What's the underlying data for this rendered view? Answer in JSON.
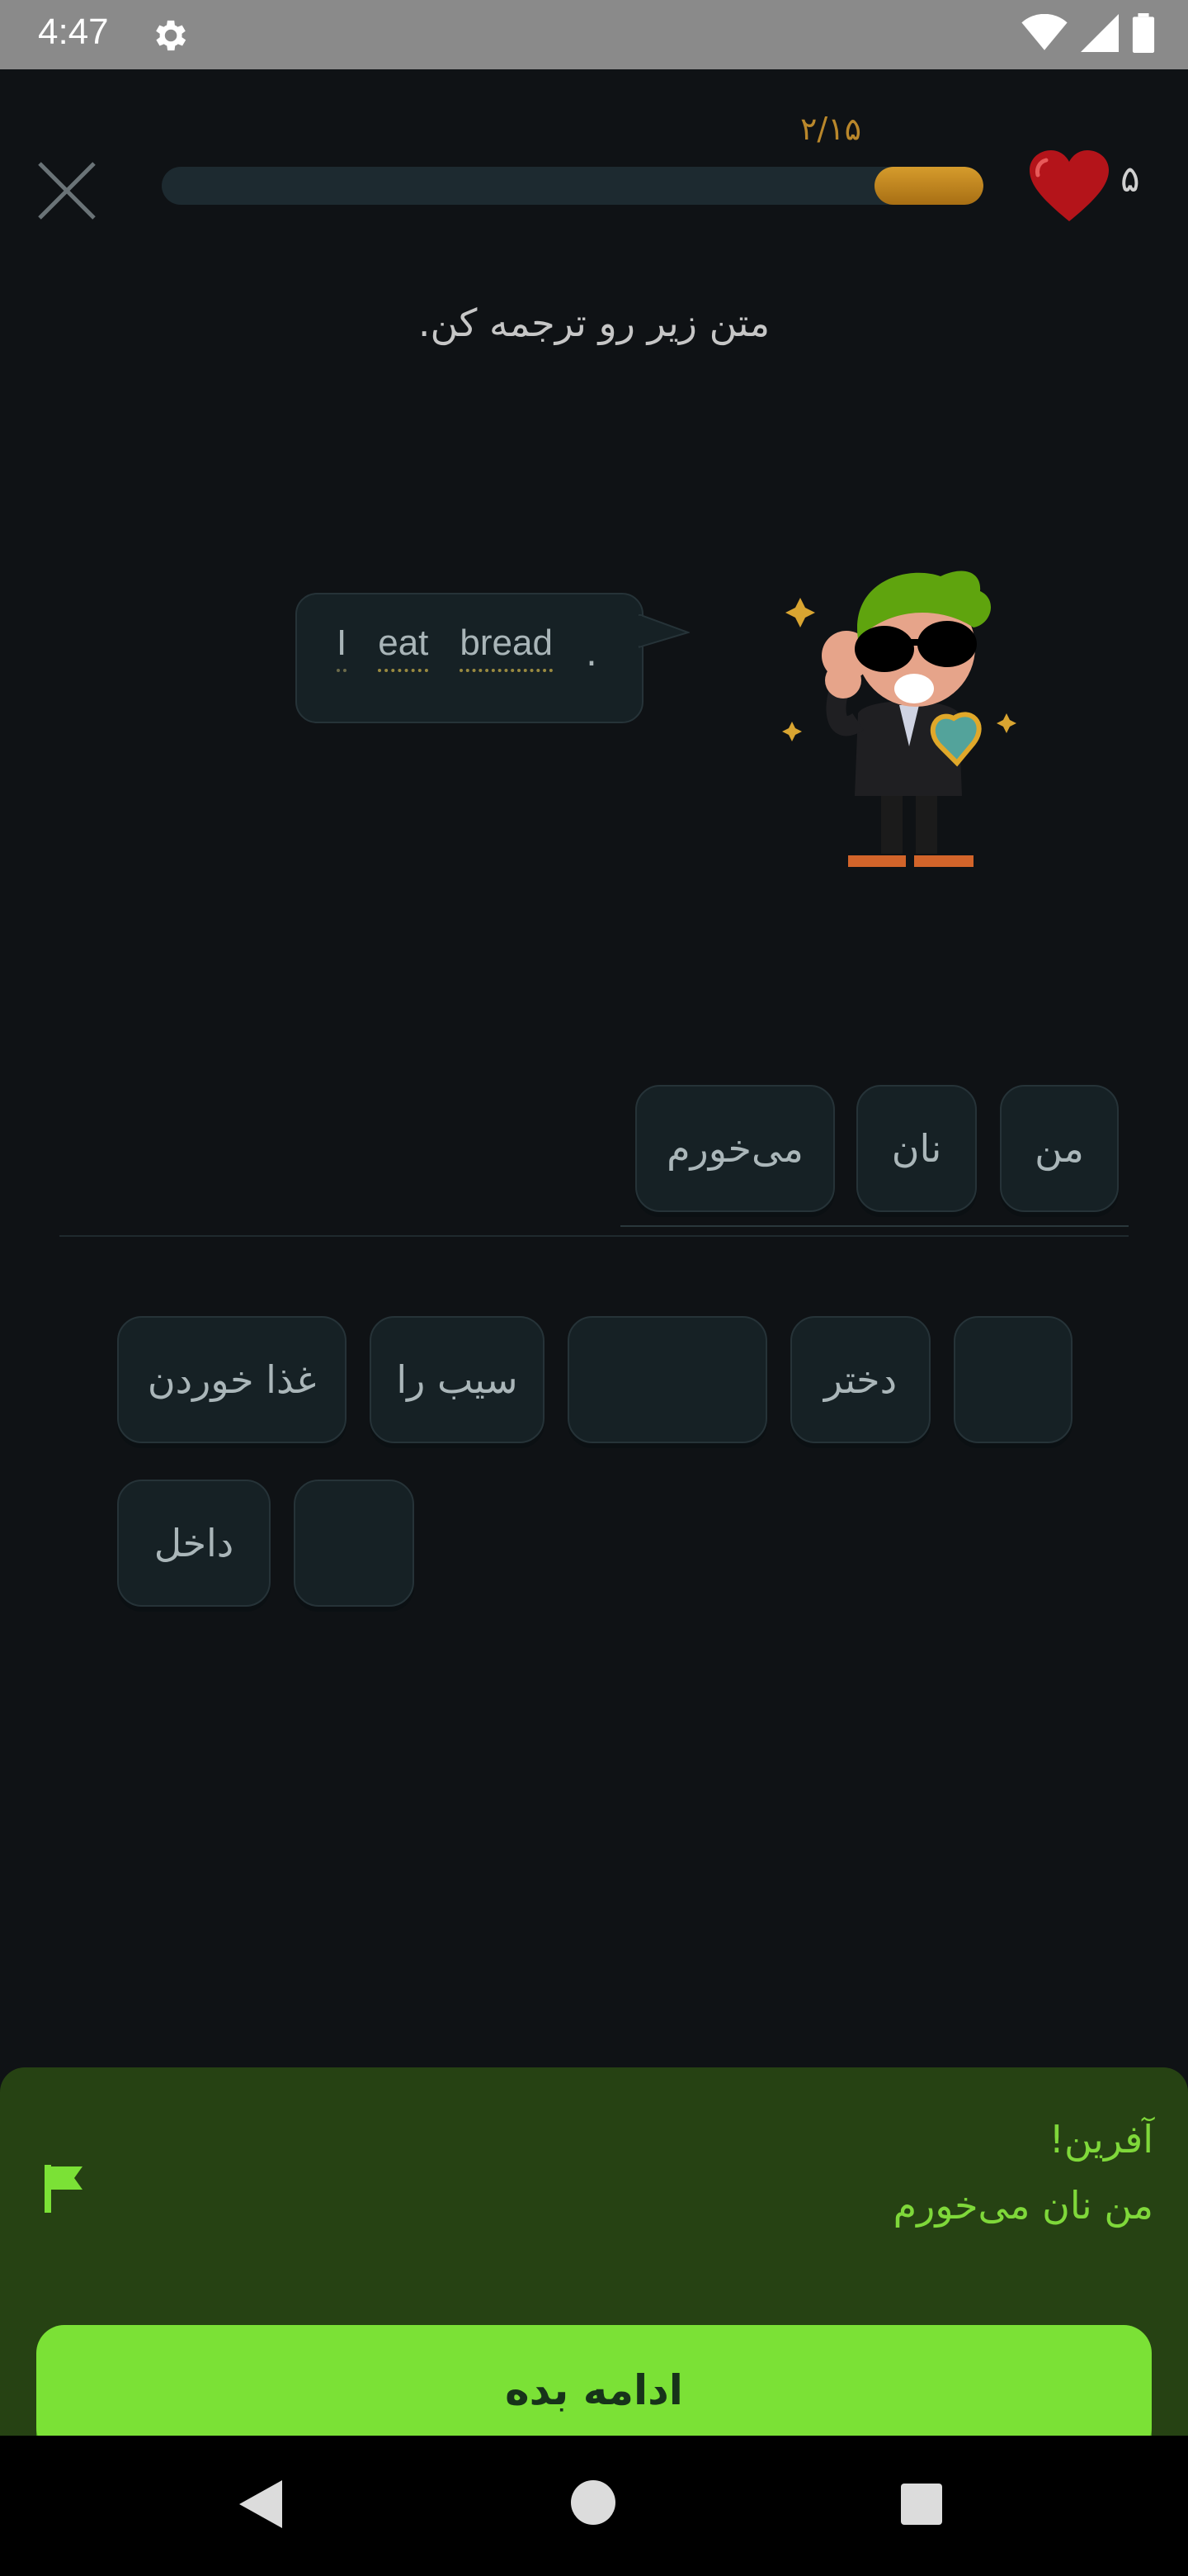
{
  "status_bar": {
    "time": "4:47"
  },
  "progress": {
    "label": "۲/۱۵",
    "fraction": 0.133
  },
  "hearts": {
    "count": "۵"
  },
  "instruction": "متن زیر رو ترجمه کن.",
  "prompt": {
    "words": [
      "I",
      "eat",
      "bread"
    ],
    "period": "."
  },
  "answer_chips": [
    "می‌خورم",
    "نان",
    "من"
  ],
  "word_bank": {
    "row1": [
      "غذا خوردن",
      "سیب را",
      "",
      "دختر",
      ""
    ],
    "row2": [
      "داخل",
      ""
    ]
  },
  "feedback": {
    "title": "آفرین!",
    "answer": "من نان می‌خورم",
    "continue_label": "ادامه بده",
    "color": "#7be136"
  }
}
